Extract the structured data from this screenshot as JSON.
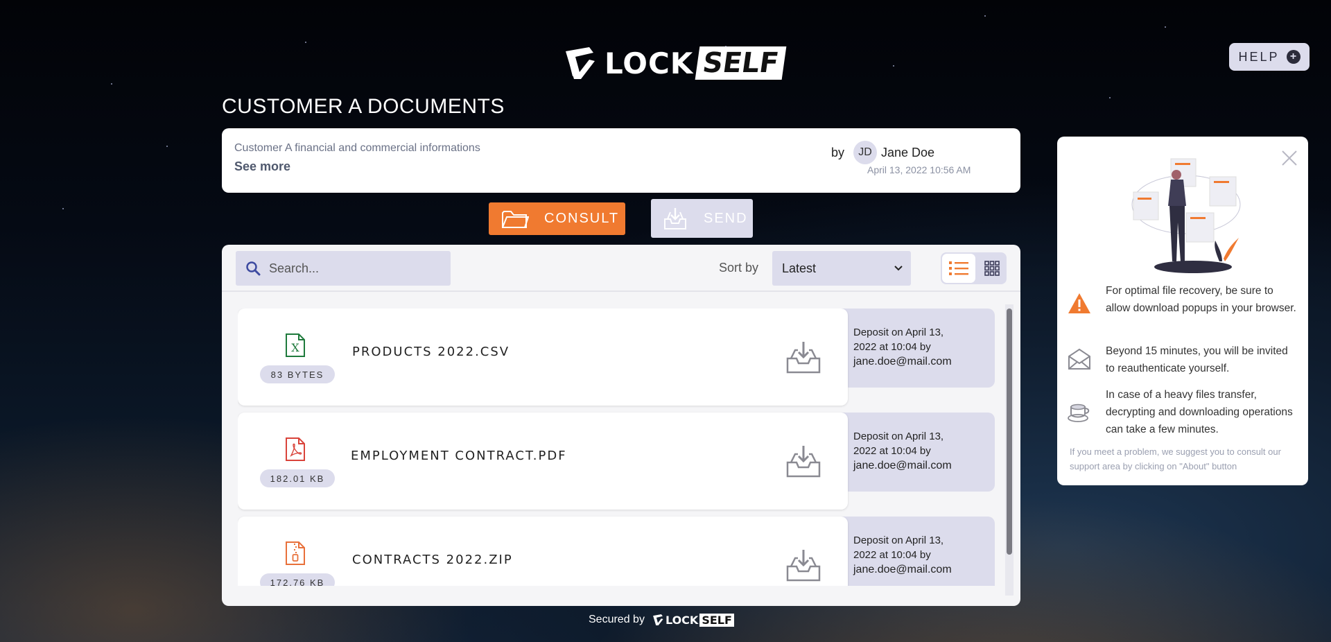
{
  "brand": {
    "logo_lock": "LOCK",
    "logo_self": "SELF",
    "accent": "#f07a30",
    "muted_bg": "#dcdcec"
  },
  "header": {
    "help_label": "HELP"
  },
  "space": {
    "title": "CUSTOMER A DOCUMENTS",
    "description": "Customer A financial and commercial informations",
    "see_more": "See more",
    "by_label": "by",
    "owner_initials": "JD",
    "owner_name": "Jane Doe",
    "date": "April 13, 2022 10:56 AM"
  },
  "actions": {
    "consult_label": "CONSULT",
    "send_label": "SEND"
  },
  "toolbar": {
    "search_placeholder": "Search...",
    "sort_label": "Sort by",
    "sort_value": "Latest",
    "active_view": "list"
  },
  "files": [
    {
      "name": "PRODUCTS 2022.CSV",
      "size": "83 BYTES",
      "type": "csv",
      "icon": "excel-file-icon",
      "deposit_line1": "Deposit on April 13,",
      "deposit_line2": "2022 at 10:04 by",
      "email": "jane.doe@mail.com"
    },
    {
      "name": "EMPLOYMENT CONTRACT.PDF",
      "size": "182.01 KB",
      "type": "pdf",
      "icon": "pdf-file-icon",
      "deposit_line1": "Deposit on April 13,",
      "deposit_line2": "2022 at 10:04 by",
      "email": "jane.doe@mail.com"
    },
    {
      "name": "CONTRACTS 2022.ZIP",
      "size": "172.76 KB",
      "type": "zip",
      "icon": "zip-file-icon",
      "deposit_line1": "Deposit on April 13,",
      "deposit_line2": "2022 at 10:04 by",
      "email": "jane.doe@mail.com"
    }
  ],
  "footer": {
    "secured_by": "Secured by"
  },
  "tips": {
    "items": [
      {
        "icon": "warning-icon",
        "text": "For optimal file recovery, be sure to allow download popups in your browser."
      },
      {
        "icon": "envelope-icon",
        "text": "Beyond 15 minutes, you will be invited to reauthenticate yourself."
      },
      {
        "icon": "coffee-cup-icon",
        "text": "In case of a heavy files transfer, decrypting and downloading operations can take a few minutes."
      }
    ],
    "note": "If you meet a problem, we suggest you to consult our support area by clicking on \"About\" button"
  }
}
